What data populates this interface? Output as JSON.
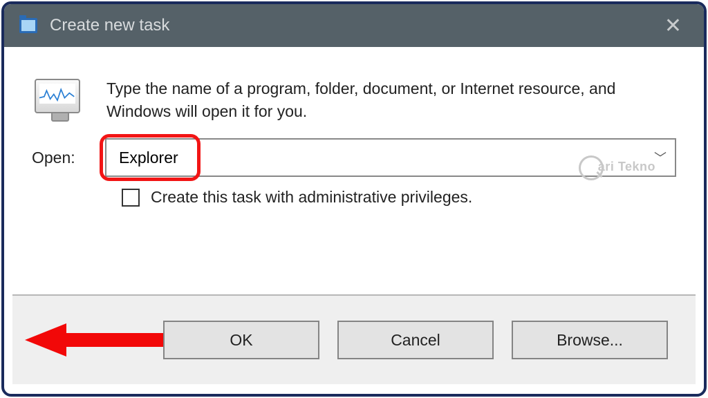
{
  "titlebar": {
    "title": "Create new task"
  },
  "dialog": {
    "instructions": "Type the name of a program, folder, document, or Internet resource, and Windows will open it for you.",
    "open_label": "Open:",
    "input_value": "Explorer",
    "admin_checkbox_label": "Create this task with administrative privileges."
  },
  "buttons": {
    "ok": "OK",
    "cancel": "Cancel",
    "browse": "Browse..."
  },
  "watermark": "ari Tekno"
}
